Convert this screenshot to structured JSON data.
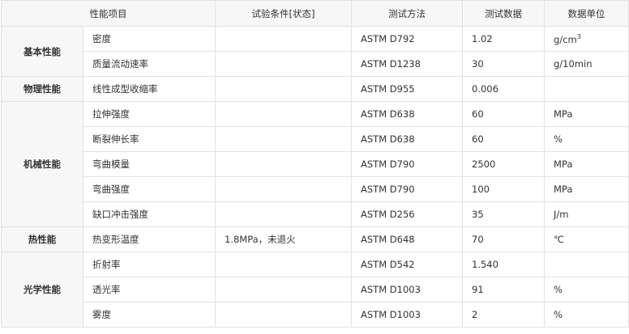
{
  "headers": [
    "性能项目",
    "试验条件[状态]",
    "测试方法",
    "测试数据",
    "数据单位"
  ],
  "groups": [
    {
      "category": "基本性能",
      "rows": [
        {
          "item": "密度",
          "condition": "",
          "method": "ASTM D792",
          "value": "1.02",
          "unit": "g/cm",
          "unit_sup": "3"
        },
        {
          "item": "质量流动速率",
          "condition": "",
          "method": "ASTM D1238",
          "value": "30",
          "unit": "g/10min"
        }
      ]
    },
    {
      "category": "物理性能",
      "rows": [
        {
          "item": "线性成型收缩率",
          "condition": "",
          "method": "ASTM D955",
          "value": "0.006",
          "unit": ""
        }
      ]
    },
    {
      "category": "机械性能",
      "rows": [
        {
          "item": "拉伸强度",
          "condition": "",
          "method": "ASTM D638",
          "value": "60",
          "unit": "MPa"
        },
        {
          "item": "断裂伸长率",
          "condition": "",
          "method": "ASTM D638",
          "value": "60",
          "unit": "%"
        },
        {
          "item": "弯曲模量",
          "condition": "",
          "method": "ASTM D790",
          "value": "2500",
          "unit": "MPa"
        },
        {
          "item": "弯曲强度",
          "condition": "",
          "method": "ASTM D790",
          "value": "100",
          "unit": "MPa"
        },
        {
          "item": "缺口冲击强度",
          "condition": "",
          "method": "ASTM D256",
          "value": "35",
          "unit": "J/m"
        }
      ]
    },
    {
      "category": "热性能",
      "rows": [
        {
          "item": "热变形温度",
          "condition": "1.8MPa，未退火",
          "method": "ASTM D648",
          "value": "70",
          "unit": "℃"
        }
      ]
    },
    {
      "category": "光学性能",
      "rows": [
        {
          "item": "折射率",
          "condition": "",
          "method": "ASTM D542",
          "value": "1.540",
          "unit": ""
        },
        {
          "item": "透光率",
          "condition": "",
          "method": "ASTM D1003",
          "value": "91",
          "unit": "%"
        },
        {
          "item": "雾度",
          "condition": "",
          "method": "ASTM D1003",
          "value": "2",
          "unit": "%"
        }
      ]
    }
  ]
}
